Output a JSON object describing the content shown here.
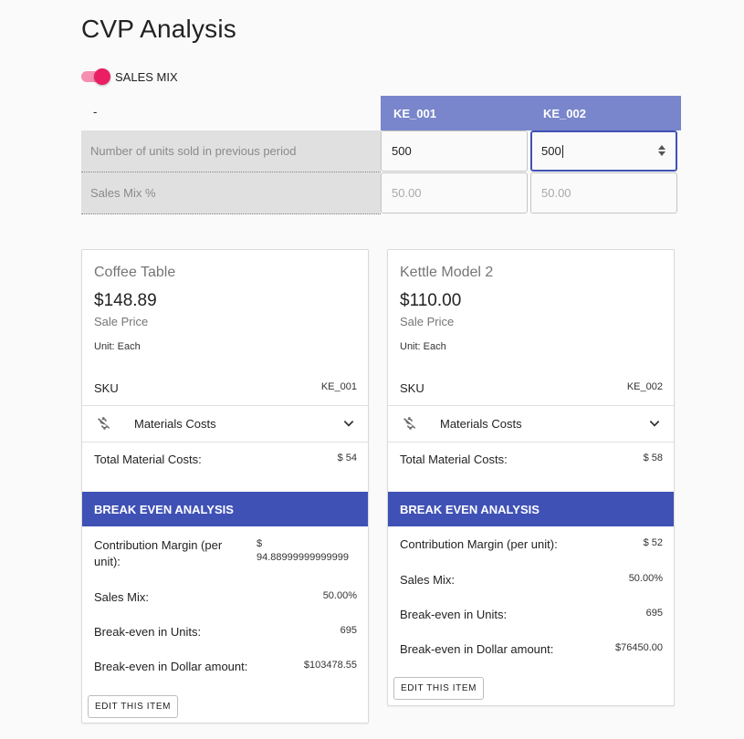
{
  "page": {
    "title": "CVP Analysis"
  },
  "toggle": {
    "label": "SALES MIX",
    "on": true,
    "accent": "#e91e63"
  },
  "table": {
    "corner": "-",
    "columns": [
      "KE_001",
      "KE_002"
    ],
    "header_color": "#7986cb",
    "rows": [
      {
        "label": "Number of units sold in previous period",
        "values": [
          "500",
          "500"
        ]
      },
      {
        "label": "Sales Mix %",
        "values": [
          "50.00",
          "50.00"
        ]
      }
    ]
  },
  "cards": [
    {
      "name": "Coffee Table",
      "price": "$148.89",
      "price_label": "Sale Price",
      "unit": "Unit: Each",
      "sku_label": "SKU",
      "sku": "KE_001",
      "materials_label": "Materials Costs",
      "materials_icon": "money-off-icon",
      "total_label": "Total Material Costs:",
      "total": "$ 54",
      "band": "BREAK EVEN ANALYSIS",
      "analysis": [
        {
          "label": "Contribution Margin (per unit):",
          "value": "$ 94.88999999999999"
        },
        {
          "label": "Sales Mix:",
          "value": "50.00%"
        },
        {
          "label": "Break-even in Units:",
          "value": "695"
        },
        {
          "label": "Break-even in Dollar amount:",
          "value": "$103478.55"
        }
      ],
      "button": "EDIT THIS ITEM"
    },
    {
      "name": "Kettle Model 2",
      "price": "$110.00",
      "price_label": "Sale Price",
      "unit": "Unit: Each",
      "sku_label": "SKU",
      "sku": "KE_002",
      "materials_label": "Materials Costs",
      "materials_icon": "money-off-icon",
      "total_label": "Total Material Costs:",
      "total": "$ 58",
      "band": "BREAK EVEN ANALYSIS",
      "analysis": [
        {
          "label": "Contribution Margin (per unit):",
          "value": "$ 52"
        },
        {
          "label": "Sales Mix:",
          "value": "50.00%"
        },
        {
          "label": "Break-even in Units:",
          "value": "695"
        },
        {
          "label": "Break-even in Dollar amount:",
          "value": "$76450.00"
        }
      ],
      "button": "EDIT THIS ITEM"
    }
  ],
  "colors": {
    "band": "#3f51b5",
    "accent": "#e91e63"
  }
}
